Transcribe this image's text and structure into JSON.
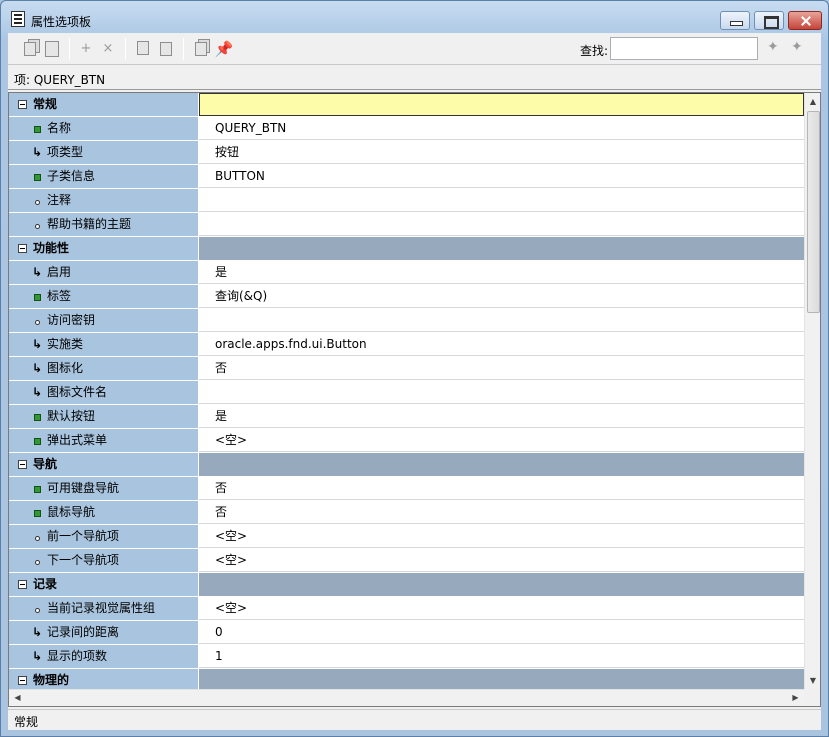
{
  "window": {
    "title": "属性选项板"
  },
  "toolbar": {
    "search_label": "查找:",
    "search_value": ""
  },
  "item_line": "项: QUERY_BTN",
  "properties": [
    {
      "kind": "category",
      "name": "常规",
      "selected": true
    },
    {
      "kind": "prop",
      "marker": "green",
      "name": "名称",
      "value": "QUERY_BTN"
    },
    {
      "kind": "prop",
      "marker": "arrow",
      "name": "项类型",
      "value": "按钮"
    },
    {
      "kind": "prop",
      "marker": "green",
      "name": "子类信息",
      "value": "BUTTON"
    },
    {
      "kind": "prop",
      "marker": "dot",
      "name": "注释",
      "value": ""
    },
    {
      "kind": "prop",
      "marker": "dot",
      "name": "帮助书籍的主题",
      "value": ""
    },
    {
      "kind": "category",
      "name": "功能性"
    },
    {
      "kind": "prop",
      "marker": "arrow",
      "name": "启用",
      "value": "是"
    },
    {
      "kind": "prop",
      "marker": "green",
      "name": "标签",
      "value": "查询(&Q)"
    },
    {
      "kind": "prop",
      "marker": "dot",
      "name": "访问密钥",
      "value": ""
    },
    {
      "kind": "prop",
      "marker": "arrow",
      "name": "实施类",
      "value": "oracle.apps.fnd.ui.Button"
    },
    {
      "kind": "prop",
      "marker": "arrow",
      "name": "图标化",
      "value": "否"
    },
    {
      "kind": "prop",
      "marker": "arrow",
      "name": "图标文件名",
      "value": ""
    },
    {
      "kind": "prop",
      "marker": "green",
      "name": "默认按钮",
      "value": "是"
    },
    {
      "kind": "prop",
      "marker": "green",
      "name": "弹出式菜单",
      "value": "<空>"
    },
    {
      "kind": "category",
      "name": "导航"
    },
    {
      "kind": "prop",
      "marker": "green",
      "name": "可用键盘导航",
      "value": "否"
    },
    {
      "kind": "prop",
      "marker": "green",
      "name": "鼠标导航",
      "value": "否"
    },
    {
      "kind": "prop",
      "marker": "dot",
      "name": "前一个导航项",
      "value": "<空>"
    },
    {
      "kind": "prop",
      "marker": "dot",
      "name": "下一个导航项",
      "value": "<空>"
    },
    {
      "kind": "category",
      "name": "记录"
    },
    {
      "kind": "prop",
      "marker": "dot",
      "name": "当前记录视觉属性组",
      "value": "<空>"
    },
    {
      "kind": "prop",
      "marker": "arrow",
      "name": "记录间的距离",
      "value": "0"
    },
    {
      "kind": "prop",
      "marker": "arrow",
      "name": "显示的项数",
      "value": "1"
    },
    {
      "kind": "category",
      "name": "物理的"
    }
  ],
  "status_text": "常规",
  "colors": {
    "name_column": "#a9c4de",
    "category_value": "#97a9bc",
    "selected_value": "#fdfca9"
  }
}
